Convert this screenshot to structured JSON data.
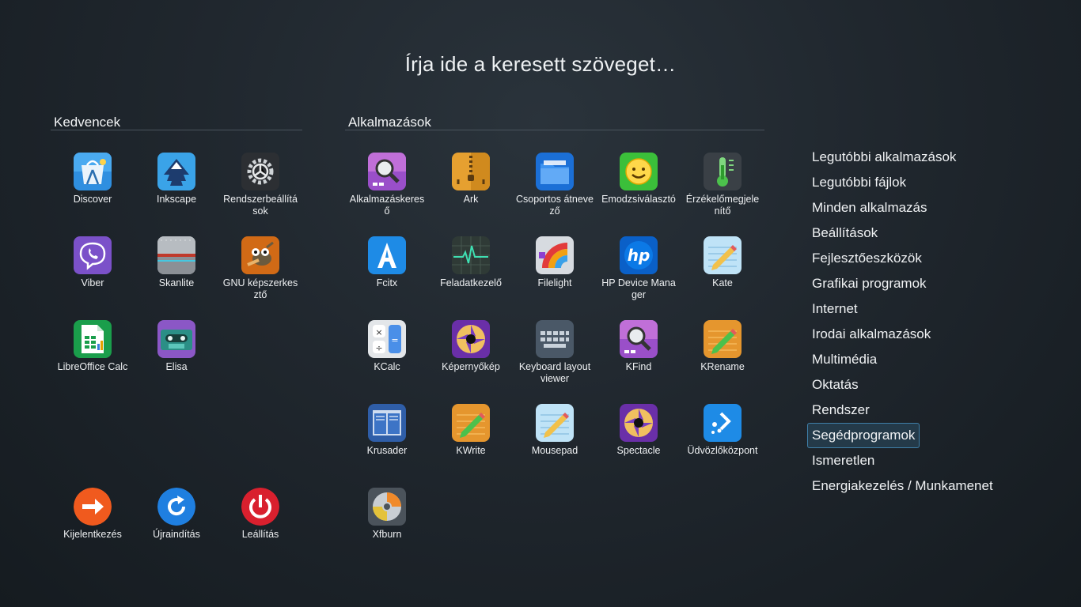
{
  "search": {
    "placeholder": "Írja ide a keresett szöveget…"
  },
  "favorites": {
    "title": "Kedvencek",
    "apps": [
      {
        "label": "Discover",
        "icon": "discover-icon"
      },
      {
        "label": "Inkscape",
        "icon": "inkscape-icon"
      },
      {
        "label": "Rendszerbeállítások",
        "icon": "system-settings-icon"
      },
      {
        "label": "Viber",
        "icon": "viber-icon"
      },
      {
        "label": "Skanlite",
        "icon": "skanlite-icon"
      },
      {
        "label": "GNU képszerkesztő",
        "icon": "gimp-icon"
      },
      {
        "label": "LibreOffice Calc",
        "icon": "libreoffice-calc-icon"
      },
      {
        "label": "Elisa",
        "icon": "elisa-icon"
      }
    ]
  },
  "session": [
    {
      "label": "Kijelentkezés",
      "icon": "logout-icon"
    },
    {
      "label": "Újraindítás",
      "icon": "restart-icon"
    },
    {
      "label": "Leállítás",
      "icon": "shutdown-icon"
    }
  ],
  "applications": {
    "title": "Alkalmazások",
    "apps": [
      {
        "label": "Alkalmazáskereső",
        "icon": "app-finder-icon"
      },
      {
        "label": "Ark",
        "icon": "ark-icon"
      },
      {
        "label": "Csoportos átnevező",
        "icon": "bulk-rename-icon"
      },
      {
        "label": "Emodzsiválasztó",
        "icon": "emoji-picker-icon"
      },
      {
        "label": "Érzékelőmegjelenítő",
        "icon": "sensor-viewer-icon"
      },
      {
        "label": "Fcitx",
        "icon": "fcitx-icon"
      },
      {
        "label": "Feladatkezelő",
        "icon": "task-manager-icon"
      },
      {
        "label": "Filelight",
        "icon": "filelight-icon"
      },
      {
        "label": "HP Device Manager",
        "icon": "hp-icon"
      },
      {
        "label": "Kate",
        "icon": "kate-icon"
      },
      {
        "label": "KCalc",
        "icon": "kcalc-icon"
      },
      {
        "label": "Képernyőkép",
        "icon": "screenshot-icon"
      },
      {
        "label": "Keyboard layout viewer",
        "icon": "keyboard-icon"
      },
      {
        "label": "KFind",
        "icon": "kfind-icon"
      },
      {
        "label": "KRename",
        "icon": "krename-icon"
      },
      {
        "label": "Krusader",
        "icon": "krusader-icon"
      },
      {
        "label": "KWrite",
        "icon": "kwrite-icon"
      },
      {
        "label": "Mousepad",
        "icon": "mousepad-icon"
      },
      {
        "label": "Spectacle",
        "icon": "spectacle-icon"
      },
      {
        "label": "Üdvözlőközpont",
        "icon": "welcome-center-icon"
      },
      {
        "label": "Xfburn",
        "icon": "xfburn-icon"
      }
    ]
  },
  "categories": [
    {
      "label": "Legutóbbi alkalmazások",
      "active": false
    },
    {
      "label": "Legutóbbi fájlok",
      "active": false
    },
    {
      "label": "Minden alkalmazás",
      "active": false
    },
    {
      "label": "Beállítások",
      "active": false
    },
    {
      "label": "Fejlesztőeszközök",
      "active": false
    },
    {
      "label": "Grafikai programok",
      "active": false
    },
    {
      "label": "Internet",
      "active": false
    },
    {
      "label": "Irodai alkalmazások",
      "active": false
    },
    {
      "label": "Multimédia",
      "active": false
    },
    {
      "label": "Oktatás",
      "active": false
    },
    {
      "label": "Rendszer",
      "active": false
    },
    {
      "label": "Segédprogramok",
      "active": true
    },
    {
      "label": "Ismeretlen",
      "active": false
    },
    {
      "label": "Energiakezelés / Munkamenet",
      "active": false
    }
  ],
  "colors": {
    "accent": "#3f7fa8",
    "active_bg": "#243a49",
    "background": "#1e252b"
  }
}
